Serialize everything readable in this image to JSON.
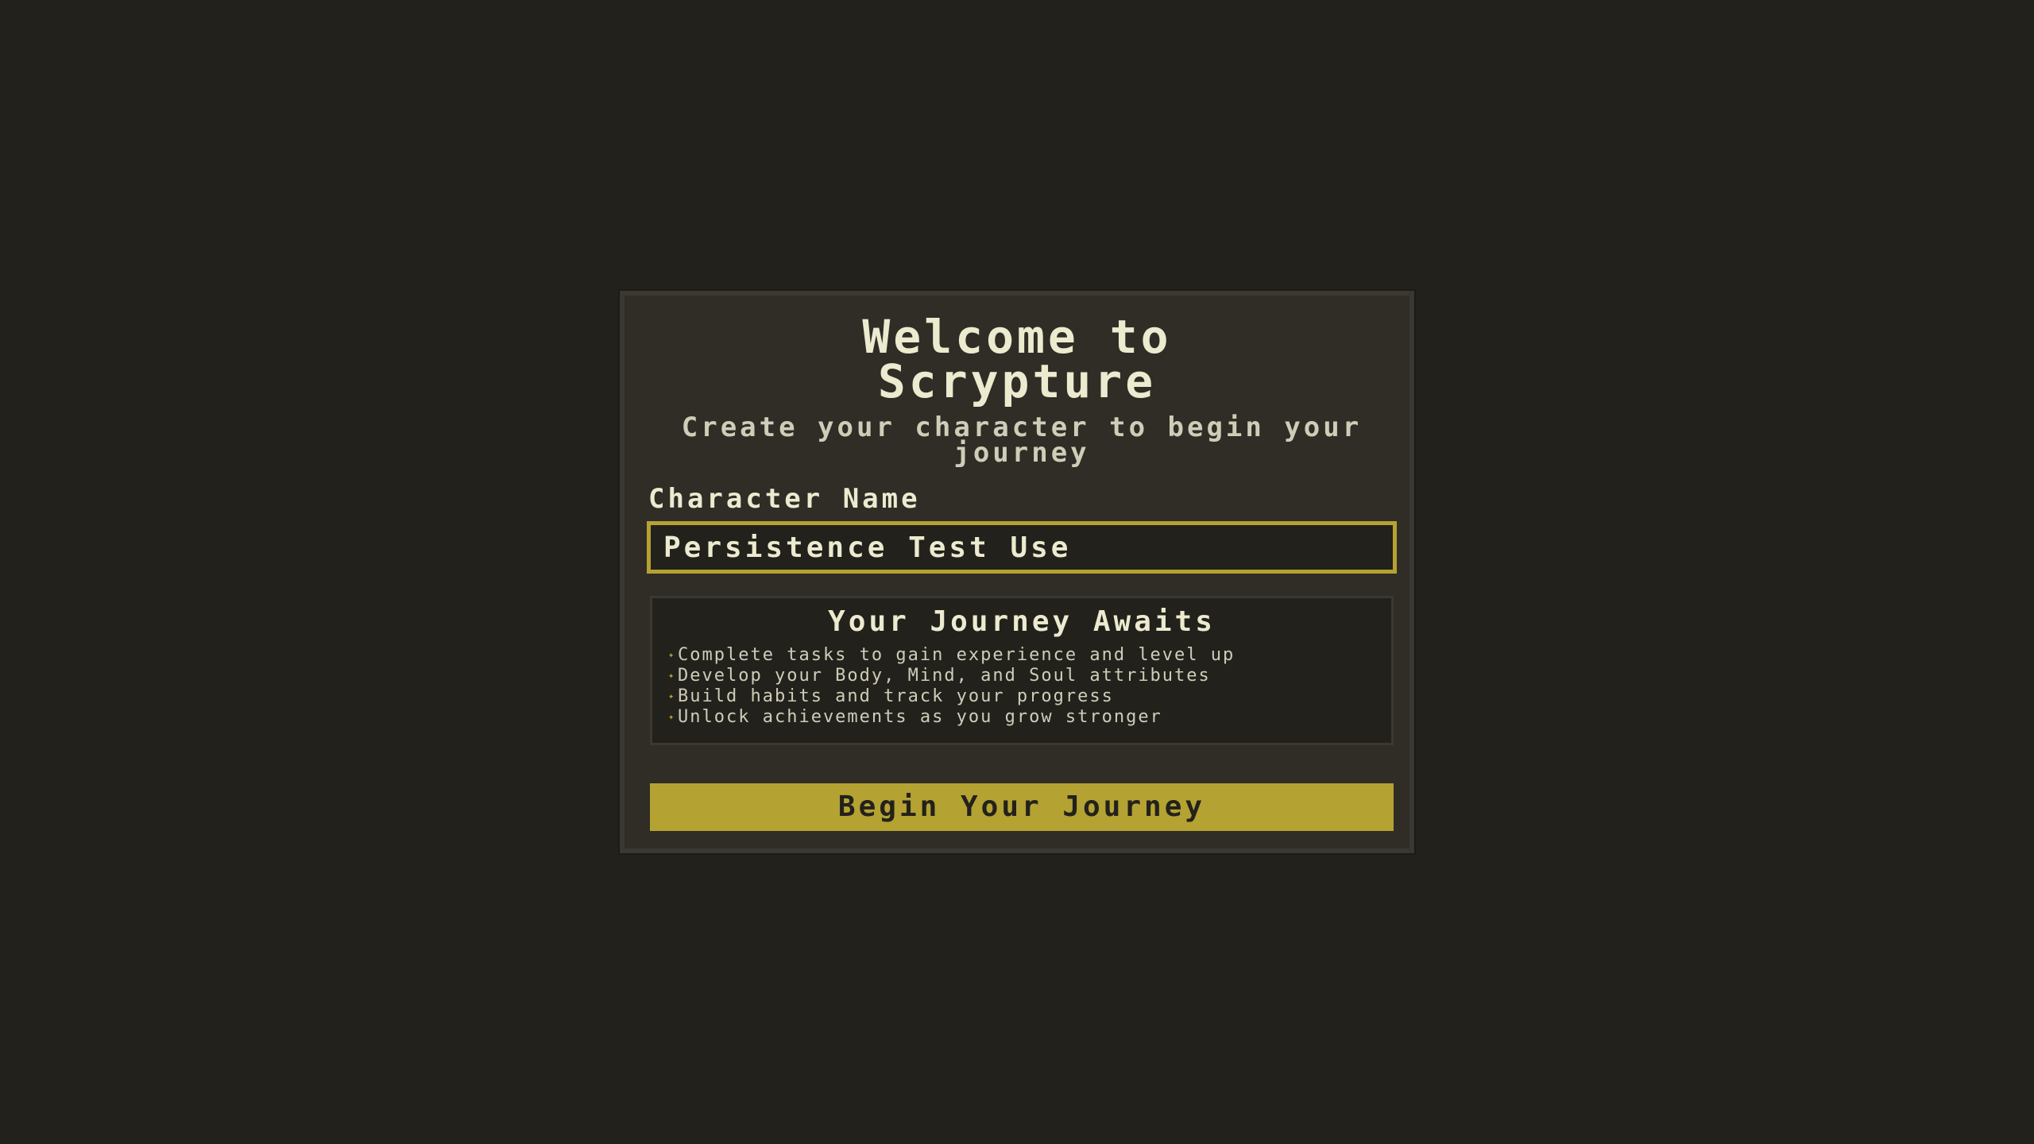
{
  "welcome": {
    "title_line1": "Welcome to",
    "title_line2": "Scrypture",
    "subtitle": "Create your character to begin your journey"
  },
  "character": {
    "label": "Character Name",
    "value": "Persistence Test Use"
  },
  "journey": {
    "title": "Your Journey Awaits",
    "items": [
      {
        "icon": "sparkle-icon",
        "text": "Complete tasks to gain experience and level up"
      },
      {
        "icon": "sparkle-icon",
        "text": "Develop your Body, Mind, and Soul attributes"
      },
      {
        "icon": "sparkle-icon",
        "text": "Build habits and track your progress"
      },
      {
        "icon": "sparkle-icon",
        "text": "Unlock achievements as you grow stronger"
      }
    ]
  },
  "actions": {
    "begin_label": "Begin Your Journey"
  },
  "colors": {
    "background": "#23211c",
    "panel": "#2f2d26",
    "accent": "#b4a232",
    "text": "#eceacf"
  }
}
